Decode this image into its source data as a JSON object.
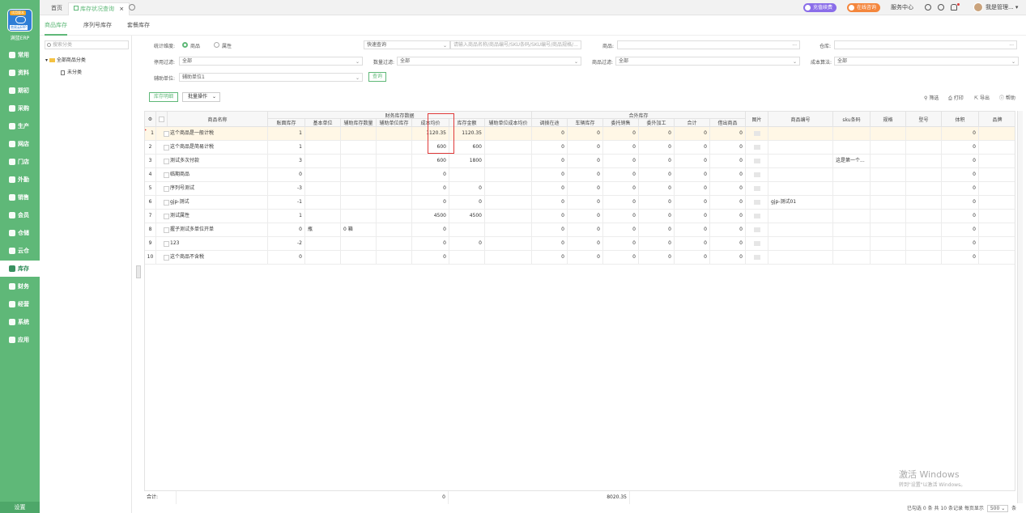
{
  "sidebar": {
    "badge": "试用版本",
    "logo_caption": "商易云ERP",
    "brand": "满篮ERP",
    "items": [
      "常用",
      "资料",
      "期初",
      "采购",
      "生产",
      "网店",
      "门店",
      "外勤",
      "销售",
      "会员",
      "仓储",
      "云仓",
      "库存",
      "财务",
      "经营",
      "系统",
      "应用"
    ],
    "active_index": 12,
    "settings": "设置"
  },
  "topbar": {
    "tabs": [
      "首页",
      "库存状况查询"
    ],
    "close": "×",
    "renew": "充值续费",
    "consult": "在线咨询",
    "service": "服务中心",
    "user": "我是管理..."
  },
  "subtabs": [
    "商品库存",
    "序列号库存",
    "套餐库存"
  ],
  "category": {
    "search_placeholder": "搜索分类",
    "root": "全部商品分类",
    "child": "未分类"
  },
  "filters": {
    "dimension_label": "统计维度:",
    "dim_goods": "商品",
    "dim_attr": "属性",
    "quick_query": "快速查询",
    "query_placeholder": "请输入商品名称/商品编号/SKU条码/SKU编号/商品规格/...",
    "goods_label": "商品:",
    "warehouse_label": "仓库:",
    "disable_label": "停用过滤:",
    "disable_value": "全部",
    "qty_label": "数量过滤:",
    "qty_value": "全部",
    "goods_filter_label": "商品过滤:",
    "goods_filter_value": "全部",
    "cost_label": "成本算法:",
    "cost_value": "全部",
    "aux_label": "辅助单位:",
    "aux_value": "辅助单位1",
    "query_btn": "查询"
  },
  "toolbar": {
    "detail": "库存明细",
    "batch": "批量操作",
    "filter": "筛选",
    "print": "打印",
    "export": "导出",
    "help": "帮助"
  },
  "table": {
    "group_finance": "财务库存数据",
    "group_contract": "合外库存",
    "headers": {
      "name": "商品名称",
      "book": "账面库存",
      "unit": "基本单位",
      "aux_qty": "辅助库存数量",
      "aux_unit": "辅助单位库存",
      "avg": "成本均价",
      "amount": "库存金额",
      "aux_avg": "辅助单位成本均价",
      "transit": "调拨在途",
      "vehicle": "车辆库存",
      "consign": "委托销售",
      "process": "委外加工",
      "total": "合计",
      "lend": "借出商品",
      "image": "图片",
      "code": "商品编号",
      "sku": "sku条码",
      "spec": "规格",
      "model": "型号",
      "volume": "体积",
      "brand": "品牌"
    },
    "rows": [
      {
        "no": "1",
        "name": "这个商品是一般计税",
        "book": "1",
        "unit": "",
        "aux": "",
        "avg": "1120.35",
        "amount": "1120.35",
        "transit": "0",
        "vehicle": "0",
        "consign": "0",
        "process": "0",
        "total": "0",
        "lend": "0",
        "code": "",
        "sku": "",
        "volume": "0"
      },
      {
        "no": "2",
        "name": "这个商品是简易计税",
        "book": "1",
        "unit": "",
        "aux": "",
        "avg": "600",
        "amount": "600",
        "transit": "0",
        "vehicle": "0",
        "consign": "0",
        "process": "0",
        "total": "0",
        "lend": "0",
        "code": "",
        "sku": "",
        "volume": "0"
      },
      {
        "no": "3",
        "name": "测试多次付款",
        "book": "3",
        "unit": "",
        "aux": "",
        "avg": "600",
        "amount": "1800",
        "transit": "0",
        "vehicle": "0",
        "consign": "0",
        "process": "0",
        "total": "0",
        "lend": "0",
        "code": "",
        "sku": "这是第一个...",
        "volume": "0"
      },
      {
        "no": "4",
        "name": "临期商品",
        "book": "0",
        "unit": "",
        "aux": "",
        "avg": "0",
        "amount": "",
        "transit": "0",
        "vehicle": "0",
        "consign": "0",
        "process": "0",
        "total": "0",
        "lend": "0",
        "code": "",
        "sku": "",
        "volume": "0"
      },
      {
        "no": "5",
        "name": "序列号测试",
        "book": "-3",
        "unit": "",
        "aux": "",
        "avg": "0",
        "amount": "0",
        "transit": "0",
        "vehicle": "0",
        "consign": "0",
        "process": "0",
        "total": "0",
        "lend": "0",
        "code": "",
        "sku": "",
        "volume": "0"
      },
      {
        "no": "6",
        "name": "gjp-测试",
        "book": "-1",
        "unit": "",
        "aux": "",
        "avg": "0",
        "amount": "0",
        "transit": "0",
        "vehicle": "0",
        "consign": "0",
        "process": "0",
        "total": "0",
        "lend": "0",
        "code": "gjp-测试01",
        "sku": "",
        "volume": "0"
      },
      {
        "no": "7",
        "name": "测试属性",
        "book": "1",
        "unit": "",
        "aux": "",
        "avg": "4500",
        "amount": "4500",
        "transit": "0",
        "vehicle": "0",
        "consign": "0",
        "process": "0",
        "total": "0",
        "lend": "0",
        "code": "",
        "sku": "",
        "volume": "0"
      },
      {
        "no": "8",
        "name": "握子测试多单位开单",
        "book": "0",
        "unit": "瓶",
        "aux": "0 箱",
        "avg": "0",
        "amount": "",
        "transit": "0",
        "vehicle": "0",
        "consign": "0",
        "process": "0",
        "total": "0",
        "lend": "0",
        "code": "",
        "sku": "",
        "volume": "0"
      },
      {
        "no": "9",
        "name": "123",
        "book": "-2",
        "unit": "",
        "aux": "",
        "avg": "0",
        "amount": "0",
        "transit": "0",
        "vehicle": "0",
        "consign": "0",
        "process": "0",
        "total": "0",
        "lend": "0",
        "code": "",
        "sku": "",
        "volume": "0"
      },
      {
        "no": "10",
        "name": "这个商品不含税",
        "book": "0",
        "unit": "",
        "aux": "",
        "avg": "0",
        "amount": "",
        "transit": "0",
        "vehicle": "0",
        "consign": "0",
        "process": "0",
        "total": "0",
        "lend": "0",
        "code": "",
        "sku": "",
        "volume": "0"
      }
    ],
    "footer": {
      "label": "合计:",
      "book": "0",
      "amount": "8020.35"
    }
  },
  "pager": {
    "text": "已勾选 0 条 共 10 条记录 每页显示",
    "size": "500",
    "unit": "条"
  },
  "watermark": {
    "line1": "激活 Windows",
    "line2": "转到\"设置\"以激活 Windows。"
  },
  "colors": {
    "accent": "#5fb878",
    "highlight": "#e03a3a",
    "renew": "#8a6de9",
    "consult": "#f4863c"
  }
}
